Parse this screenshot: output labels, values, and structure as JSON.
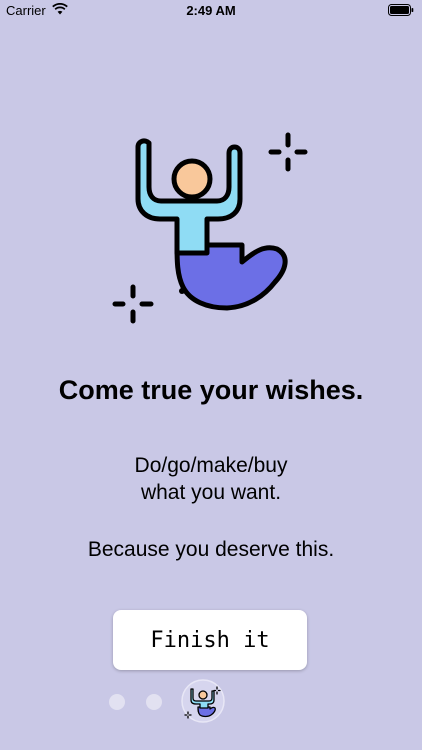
{
  "status_bar": {
    "carrier": "Carrier",
    "time": "2:49 AM"
  },
  "onboarding": {
    "title": "Come true your wishes.",
    "subtitle_lines": [
      "Do/go/make/buy",
      "what you want."
    ],
    "tagline": "Because you deserve this.",
    "button_label": "Finish it",
    "page_count": 3,
    "current_page": 3
  },
  "colors": {
    "background": "#c9c8e6",
    "shirt": "#8fdcf4",
    "skin": "#f9c89b",
    "tail": "#6c6fe6",
    "outline": "#000000"
  },
  "icons": {
    "illustration": "happy-genie-icon",
    "sparkle": "sparkle-icon",
    "wifi": "wifi-icon",
    "battery": "battery-icon"
  }
}
